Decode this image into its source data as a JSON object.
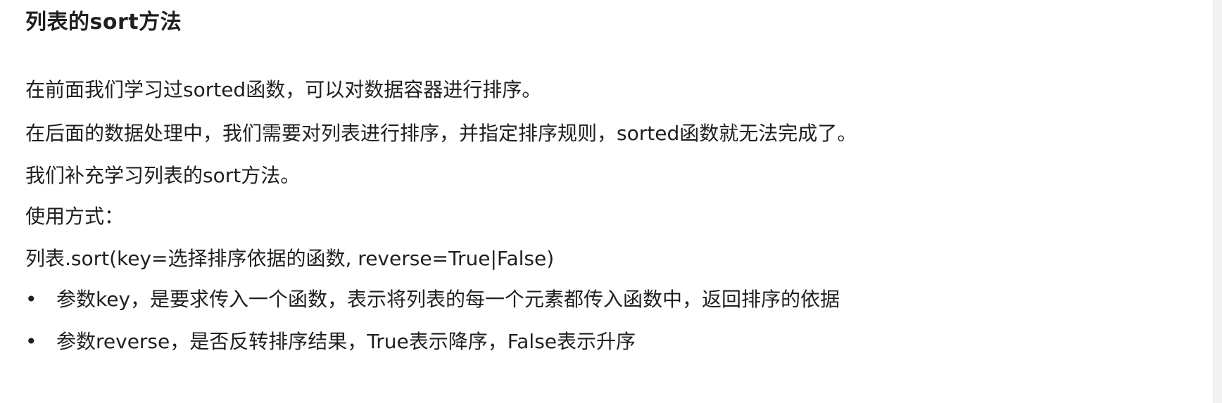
{
  "title": "列表的sort方法",
  "paragraphs": [
    "在前面我们学习过sorted函数，可以对数据容器进行排序。",
    "在后面的数据处理中，我们需要对列表进行排序，并指定排序规则，sorted函数就无法完成了。",
    "我们补充学习列表的sort方法。",
    "使用方式：",
    "列表.sort(key=选择排序依据的函数, reverse=True|False)"
  ],
  "bullets": [
    "参数key，是要求传入一个函数，表示将列表的每一个元素都传入函数中，返回排序的依据",
    "参数reverse，是否反转排序结果，True表示降序，False表示升序"
  ],
  "bullet_symbol": "•"
}
